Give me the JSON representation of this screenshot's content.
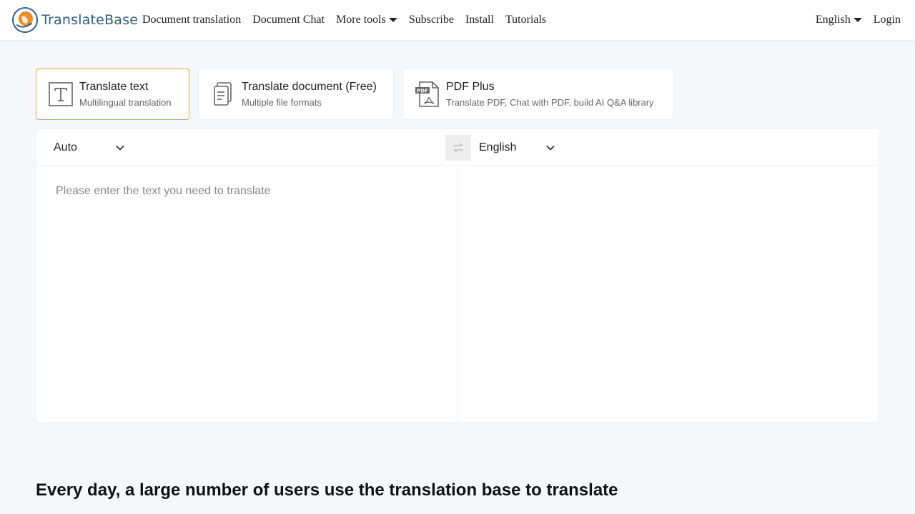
{
  "header": {
    "brand": "TranslateBase",
    "nav": [
      {
        "label": "Document translation"
      },
      {
        "label": "Document Chat"
      },
      {
        "label": "More tools",
        "has_dropdown": true
      },
      {
        "label": "Subscribe"
      },
      {
        "label": "Install"
      },
      {
        "label": "Tutorials"
      }
    ],
    "language": "English",
    "login": "Login"
  },
  "modes": [
    {
      "title": "Translate text",
      "subtitle": "Multilingual translation",
      "icon": "text-t-icon",
      "active": true
    },
    {
      "title": "Translate document (Free)",
      "subtitle": "Multiple file formats",
      "icon": "document-icon",
      "active": false
    },
    {
      "title": "PDF Plus",
      "subtitle": "Translate PDF, Chat with PDF, build AI Q&A library",
      "icon": "pdf-icon",
      "badge": "PDF",
      "active": false
    }
  ],
  "translator": {
    "source_language": "Auto",
    "target_language": "English",
    "swap_icon": "swap-arrows-icon",
    "source_placeholder": "Please enter the text you need to translate",
    "source_text": "",
    "target_text": ""
  },
  "headline": "Every day, a large number of users use the translation base to translate",
  "colors": {
    "accent_border": "#e8a33d",
    "brand_text": "#2c5f8a",
    "logo_orange": "#f08a24",
    "background": "#f5f7fb"
  }
}
